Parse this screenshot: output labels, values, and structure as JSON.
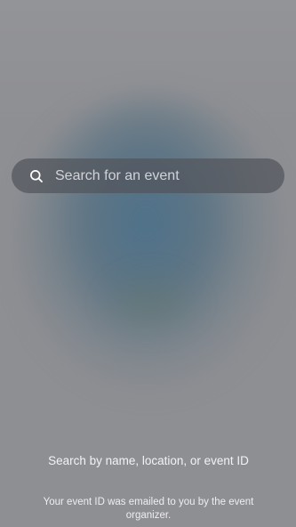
{
  "search": {
    "placeholder": "Search for an event",
    "icon": "search-icon"
  },
  "hints": {
    "title": "Search by name, location, or event ID",
    "subtitle": "Your event ID was emailed to you by the event organizer."
  },
  "colors": {
    "background": "#8e8f93",
    "search_bar": "#52545c",
    "text": "#ffffff"
  }
}
